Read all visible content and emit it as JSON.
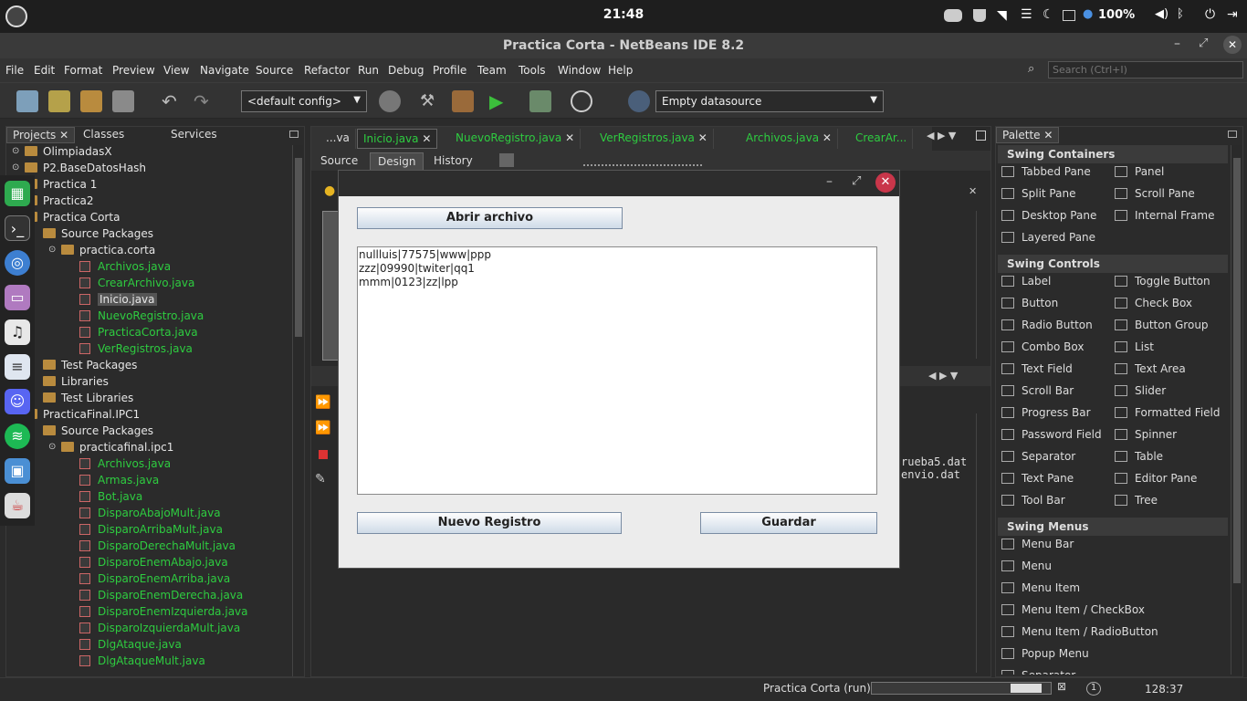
{
  "system": {
    "clock": "21:48",
    "battery": "100%"
  },
  "window": {
    "title": "Practica Corta - NetBeans IDE 8.2"
  },
  "menubar": {
    "items": [
      "File",
      "Edit",
      "Format",
      "Preview",
      "View",
      "Navigate",
      "Source",
      "Refactor",
      "Run",
      "Debug",
      "Profile",
      "Team",
      "Tools",
      "Window",
      "Help"
    ],
    "search_placeholder": "Search (Ctrl+I)"
  },
  "toolbar": {
    "config_value": "<default config>",
    "datasource_value": "Empty datasource"
  },
  "projects_panel": {
    "tabs": [
      "Projects",
      "Classes",
      "Services"
    ],
    "tree": [
      {
        "label": "OlimpiadasX",
        "green": false
      },
      {
        "label": "P2.BaseDatosHash",
        "green": false
      },
      {
        "label": "Practica 1",
        "green": false
      },
      {
        "label": "Practica2",
        "green": false
      },
      {
        "label": "Practica Corta",
        "green": false
      },
      {
        "label": "Source Packages",
        "green": false
      },
      {
        "label": "practica.corta",
        "green": false
      },
      {
        "label": "Archivos.java",
        "green": true
      },
      {
        "label": "CrearArchivo.java",
        "green": true
      },
      {
        "label": "Inicio.java",
        "green": false
      },
      {
        "label": "NuevoRegistro.java",
        "green": true
      },
      {
        "label": "PracticaCorta.java",
        "green": true
      },
      {
        "label": "VerRegistros.java",
        "green": true
      },
      {
        "label": "Test Packages",
        "green": false
      },
      {
        "label": "Libraries",
        "green": false
      },
      {
        "label": "Test Libraries",
        "green": false
      },
      {
        "label": "PracticaFinal.IPC1",
        "green": false
      },
      {
        "label": "Source Packages",
        "green": false
      },
      {
        "label": "practicafinal.ipc1",
        "green": false
      },
      {
        "label": "Archivos.java",
        "green": true
      },
      {
        "label": "Armas.java",
        "green": true
      },
      {
        "label": "Bot.java",
        "green": true
      },
      {
        "label": "DisparoAbajoMult.java",
        "green": true
      },
      {
        "label": "DisparoArribaMult.java",
        "green": true
      },
      {
        "label": "DisparoDerechaMult.java",
        "green": true
      },
      {
        "label": "DisparoEnemAbajo.java",
        "green": true
      },
      {
        "label": "DisparoEnemArriba.java",
        "green": true
      },
      {
        "label": "DisparoEnemDerecha.java",
        "green": true
      },
      {
        "label": "DisparoEnemIzquierda.java",
        "green": true
      },
      {
        "label": "DisparoIzquierdaMult.java",
        "green": true
      },
      {
        "label": "DlgAtaque.java",
        "green": true
      },
      {
        "label": "DlgAtaqueMult.java",
        "green": true
      }
    ]
  },
  "editor": {
    "tabs": [
      "...va",
      "Inicio.java",
      "NuevoRegistro.java",
      "VerRegistros.java",
      "Archivos.java",
      "CrearAr..."
    ],
    "subtabs": [
      "Source",
      "Design",
      "History"
    ],
    "output_lines": [
      "rueba5.dat",
      "envio.dat"
    ]
  },
  "palette": {
    "title": "Palette",
    "sections": [
      {
        "name": "Swing Containers",
        "items": [
          "Tabbed Pane",
          "Panel",
          "Split Pane",
          "Scroll Pane",
          "Desktop Pane",
          "Internal Frame",
          "Layered Pane"
        ]
      },
      {
        "name": "Swing Controls",
        "items": [
          "Label",
          "Toggle Button",
          "Button",
          "Check Box",
          "Radio Button",
          "Button Group",
          "Combo Box",
          "List",
          "Text Field",
          "Text Area",
          "Scroll Bar",
          "Slider",
          "Progress Bar",
          "Formatted Field",
          "Password Field",
          "Spinner",
          "Separator",
          "Table",
          "Text Pane",
          "Editor Pane",
          "Tool Bar",
          "Tree"
        ]
      },
      {
        "name": "Swing Menus",
        "items": [
          "Menu Bar",
          "Menu",
          "Menu Item",
          "Menu Item / CheckBox",
          "Menu Item / RadioButton",
          "Popup Menu",
          "Separator"
        ]
      }
    ]
  },
  "status": {
    "task": "Practica Corta (run)",
    "notifications": "1",
    "position": "128:37"
  },
  "dialog": {
    "open_button": "Abrir archivo",
    "text_lines": [
      "nullluis|77575|www|ppp",
      "zzz|09990|twiter|qq1",
      "mmm|0123|zz|lpp"
    ],
    "new_button": "Nuevo Registro",
    "save_button": "Guardar"
  }
}
